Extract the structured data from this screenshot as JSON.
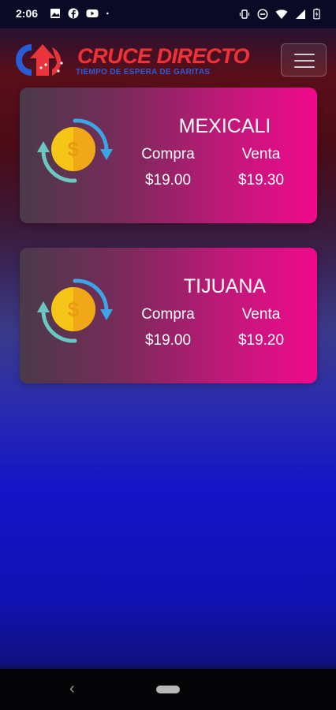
{
  "status_bar": {
    "time": "2:06",
    "icons_left": [
      "image-icon",
      "facebook-icon",
      "youtube-icon",
      "dot-icon"
    ],
    "icons_right": [
      "vibrate-icon",
      "do-not-disturb-icon",
      "wifi-icon",
      "signal-icon",
      "battery-charging-icon"
    ]
  },
  "header": {
    "logo_title": "CRUCE DIRECTO",
    "logo_subtitle": "TIEMPO DE ESPERA DE GARITAS",
    "menu_icon": "hamburger-menu-icon"
  },
  "cards": [
    {
      "city": "MEXICALI",
      "buy_label": "Compra",
      "sell_label": "Venta",
      "buy_value": "$19.00",
      "sell_value": "$19.30",
      "icon": "currency-exchange-icon"
    },
    {
      "city": "TIJUANA",
      "buy_label": "Compra",
      "sell_label": "Venta",
      "buy_value": "$19.00",
      "sell_value": "$19.20",
      "icon": "currency-exchange-icon"
    }
  ],
  "nav": {
    "back_icon": "back-icon",
    "home_icon": "home-pill-icon"
  },
  "colors": {
    "logo_red": "#e8343a",
    "logo_blue": "#2a5cd6",
    "card_pink": "#f00a8c"
  }
}
